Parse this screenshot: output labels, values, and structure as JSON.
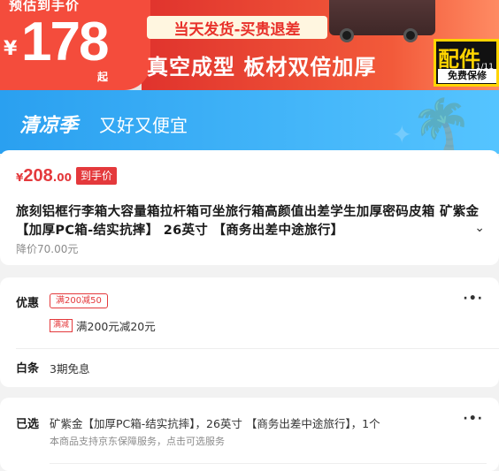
{
  "hero": {
    "badge_label": "预估到手价",
    "currency": "¥",
    "price": "178",
    "qi": "起",
    "ship_tag": "当天发货-买贵退差",
    "headline": "真空成型 板材双倍加厚",
    "parts_title": "配件",
    "parts_sub": "免费保修",
    "parts_page": "1/11"
  },
  "season": {
    "brand": "清凉季",
    "slogan": "又好又便宜"
  },
  "product": {
    "currency": "¥",
    "price_int": "208",
    "price_dec": ".00",
    "hand_tag": "到手价",
    "title": "旅刻铝框行李箱大容量箱拉杆箱可坐旅行箱高颜值出差学生加厚密码皮箱 矿紫金【加厚PC箱-结实抗摔】 26英寸 【商务出差中途旅行】",
    "price_drop": "降价70.00元"
  },
  "offers": {
    "label": "优惠",
    "coupon": "满200减50",
    "mj_tag": "满减",
    "mj_text": "满200元减20元",
    "baitiao_label": "白条",
    "baitiao_text": "3期免息"
  },
  "selected": {
    "label": "已选",
    "text": "矿紫金【加厚PC箱-结实抗摔】，26英寸 【商务出差中途旅行】，1个",
    "sub": "本商品支持京东保障服务，点击可选服务"
  },
  "colors": {
    "accent_red": "#e4393c",
    "season_blue": "#2aa0f0"
  },
  "icons": [
    "chevron-down-icon",
    "more-dots-icon",
    "palm-tree-icon"
  ]
}
